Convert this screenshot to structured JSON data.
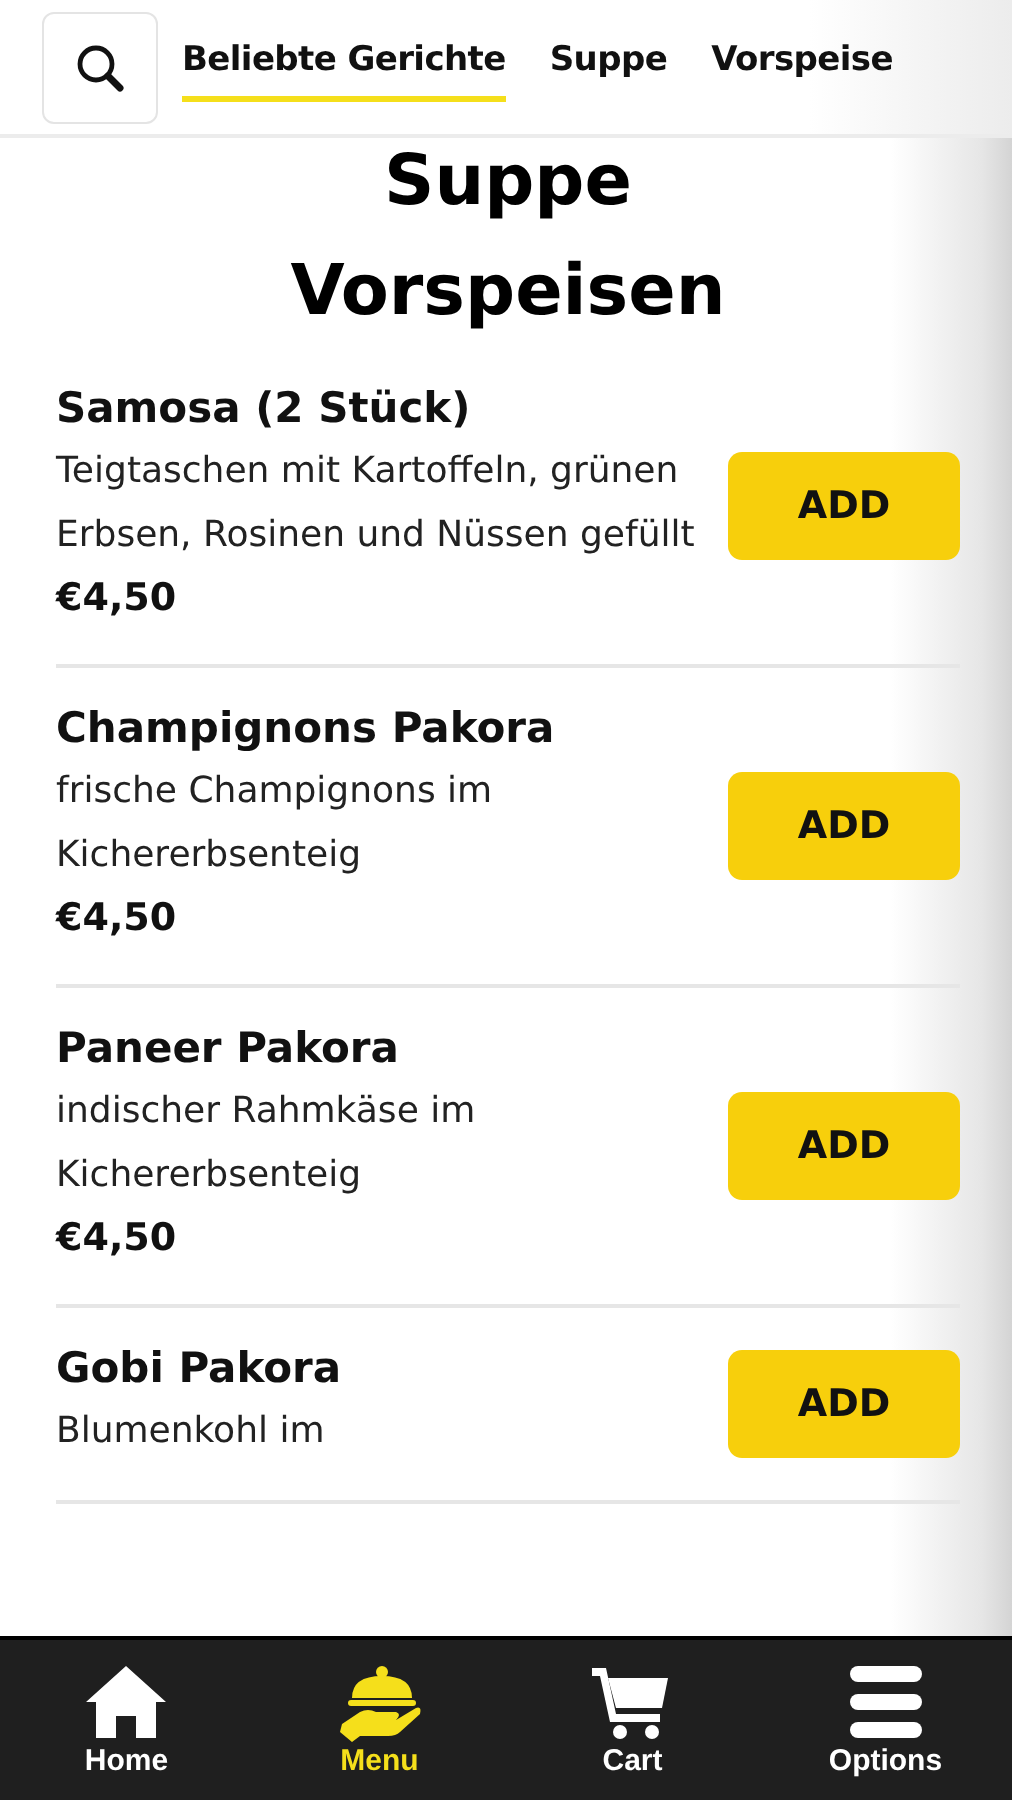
{
  "category_tabs": [
    {
      "label": "Beliebte Gerichte",
      "selected": true
    },
    {
      "label": "Suppe",
      "selected": false
    },
    {
      "label": "Vorspeise",
      "selected": false
    }
  ],
  "sections": [
    {
      "title": "Suppe"
    },
    {
      "title": "Vorspeisen",
      "items": [
        {
          "name": "Samosa (2 Stück)",
          "description": "Teigtaschen mit Kartoffeln, grünen Erbsen, Rosinen und Nüssen gefüllt",
          "price": "€4,50",
          "button": "ADD"
        },
        {
          "name": "Champignons Pakora",
          "description": "frische Champignons im Kichererbsenteig",
          "price": "€4,50",
          "button": "ADD"
        },
        {
          "name": "Paneer Pakora",
          "description": "indischer Rahmkäse im Kichererbsenteig",
          "price": "€4,50",
          "button": "ADD"
        },
        {
          "name": "Gobi Pakora",
          "description": "Blumenkohl im",
          "button": "ADD"
        }
      ]
    }
  ],
  "bottom_nav": [
    {
      "label": "Home",
      "kind": "home",
      "selected": false
    },
    {
      "label": "Menu",
      "kind": "menu",
      "selected": true
    },
    {
      "label": "Cart",
      "kind": "cart",
      "selected": false
    },
    {
      "label": "Options",
      "kind": "options",
      "selected": false
    }
  ]
}
